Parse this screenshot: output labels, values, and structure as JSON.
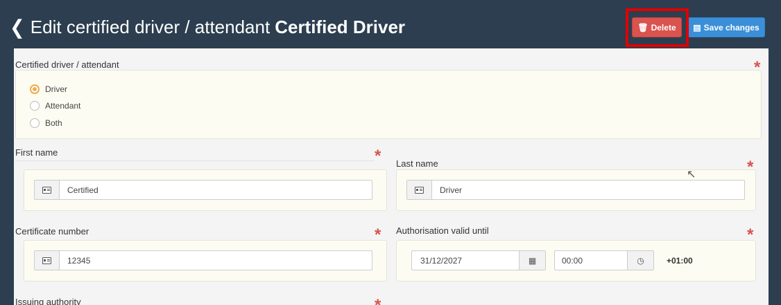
{
  "header": {
    "back_icon": "chevron-left-icon",
    "title_prefix": "Edit certified driver / attendant",
    "title_name": "Certified Driver",
    "delete_label": "Delete",
    "delete_icon": "trash-icon",
    "save_label": "Save changes",
    "save_icon": "save-icon"
  },
  "colors": {
    "header_bg": "#2c3e4f",
    "delete": "#d9534f",
    "save": "#3a8fd8",
    "required": "#d9534f",
    "radio_selected": "#f0ad4e",
    "highlight": "#e00000"
  },
  "role": {
    "label": "Certified driver / attendant",
    "options": [
      "Driver",
      "Attendant",
      "Both"
    ],
    "selected": "Driver"
  },
  "first_name": {
    "label": "First name",
    "value": "Certified"
  },
  "last_name": {
    "label": "Last name",
    "value": "Driver"
  },
  "certificate": {
    "label": "Certificate number",
    "value": "12345"
  },
  "authorisation": {
    "label": "Authorisation valid until",
    "date": "31/12/2027",
    "time": "00:00",
    "timezone": "+01:00"
  },
  "issuing": {
    "label": "Issuing authority"
  },
  "required_mark": "*"
}
